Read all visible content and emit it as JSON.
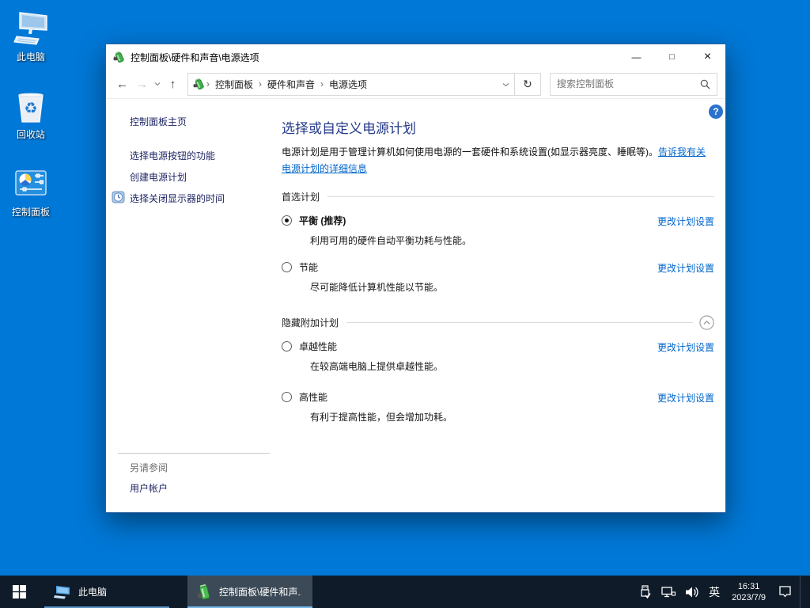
{
  "colors": {
    "desktop_background": "#0078d7",
    "link_blue": "#0066cc",
    "heading_blue": "#243a8a",
    "taskbar_background": "#0f1b28",
    "taskbar_accent_underline": "#76b9ed",
    "help_badge_blue": "#2a72cc"
  },
  "desktop": {
    "icons": [
      {
        "label": "此电脑"
      },
      {
        "label": "回收站"
      },
      {
        "label": "控制面板"
      }
    ]
  },
  "window": {
    "title": "控制面板\\硬件和声音\\电源选项",
    "controls": {
      "minimize": "—",
      "maximize": "□",
      "close": "×"
    },
    "navbar": {
      "back": "←",
      "forward": "→",
      "up": "↑",
      "refresh": "↻",
      "crumbs": [
        "控制面板",
        "硬件和声音",
        "电源选项"
      ],
      "crumb_separator": "›",
      "search_placeholder": "搜索控制面板"
    },
    "sidebar": {
      "items": [
        {
          "label": "控制面板主页"
        },
        {
          "label": "选择电源按钮的功能"
        },
        {
          "label": "创建电源计划"
        },
        {
          "label": "选择关闭显示器的时间",
          "icon": "clock-icon"
        }
      ],
      "see_also": {
        "heading": "另请参阅",
        "items": [
          "用户帐户"
        ]
      }
    },
    "main": {
      "help_glyph": "?",
      "heading": "选择或自定义电源计划",
      "description": "电源计划是用于管理计算机如何使用电源的一套硬件和系统设置(如显示器亮度、睡眠等)。",
      "description_link": "告诉我有关电源计划的详细信息",
      "sections": [
        {
          "title": "首选计划",
          "plans": [
            {
              "label": "平衡 (推荐)",
              "selected": true,
              "description": "利用可用的硬件自动平衡功耗与性能。",
              "link": "更改计划设置"
            },
            {
              "label": "节能",
              "selected": false,
              "description": "尽可能降低计算机性能以节能。",
              "link": "更改计划设置"
            }
          ]
        },
        {
          "title": "隐藏附加计划",
          "collapsible": true,
          "plans": [
            {
              "label": "卓越性能",
              "selected": false,
              "description": "在较高端电脑上提供卓越性能。",
              "link": "更改计划设置"
            },
            {
              "label": "高性能",
              "selected": false,
              "description": "有利于提高性能，但会增加功耗。",
              "link": "更改计划设置"
            }
          ]
        }
      ]
    }
  },
  "taskbar": {
    "items": [
      {
        "label": "此电脑",
        "active": false,
        "icon": "this-pc-icon"
      },
      {
        "label": "控制面板\\硬件和声...",
        "active": true,
        "icon": "power-options-icon"
      }
    ],
    "tray": {
      "icons": [
        "usb-icon",
        "network-icon",
        "volume-icon"
      ],
      "ime": "英",
      "time": "16:31",
      "date": "2023/7/9"
    }
  }
}
